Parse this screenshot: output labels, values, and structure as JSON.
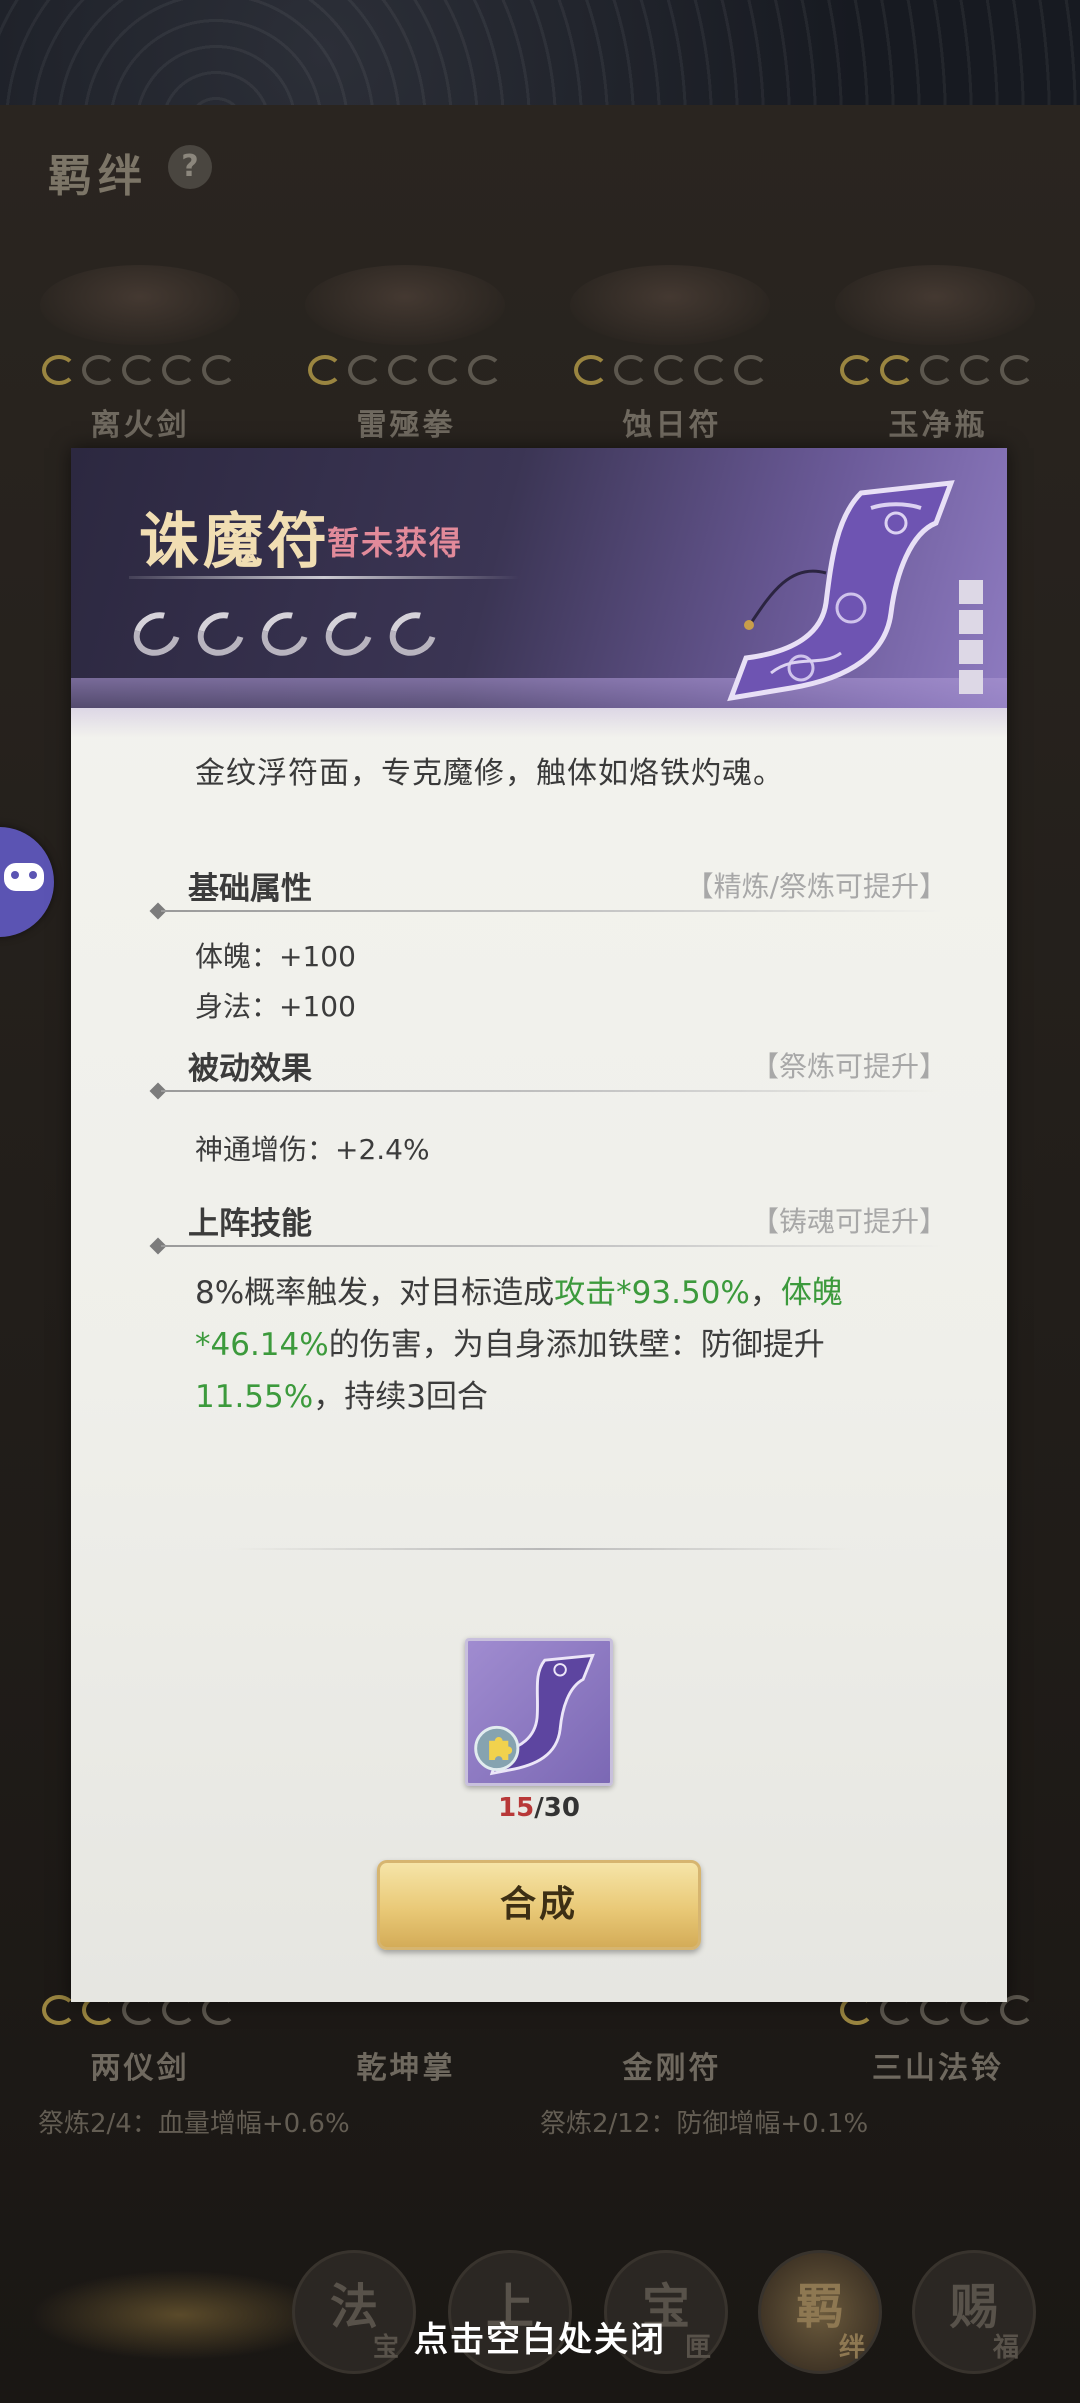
{
  "background": {
    "title": "羁绊",
    "help_icon": "?",
    "items_top": [
      {
        "name": "离火剑"
      },
      {
        "name": "雷殛拳"
      },
      {
        "name": "蚀日符"
      },
      {
        "name": "玉净瓶"
      }
    ],
    "items_bottom": [
      {
        "name": "两仪剑"
      },
      {
        "name": "乾坤掌"
      },
      {
        "name": "金刚符"
      },
      {
        "name": "三山法铃"
      }
    ],
    "stats_bottom": [
      "祭炼2/4：血量增幅+0.6%",
      "祭炼2/12：防御增幅+0.1%"
    ],
    "nav_tabs": [
      {
        "label": "法",
        "sub": "宝"
      },
      {
        "label": "上",
        "sub": ""
      },
      {
        "label": "宝",
        "sub": "匣"
      },
      {
        "label": "羁",
        "sub": "绊",
        "active": true
      },
      {
        "label": "赐",
        "sub": "福"
      }
    ]
  },
  "modal": {
    "item_name": "诛魔符",
    "status": "暂未获得",
    "rank_stars": 5,
    "description": "金纹浮符面，专克魔修，触体如烙铁灼魂。",
    "sections": {
      "base": {
        "title": "基础属性",
        "hint": "【精炼/祭炼可提升】",
        "stats": [
          "体魄：+100",
          "身法：+100"
        ]
      },
      "passive": {
        "title": "被动效果",
        "hint": "【祭炼可提升】",
        "stats": [
          "神通增伤：+2.4%"
        ]
      },
      "skill": {
        "title": "上阵技能",
        "hint": "【铸魂可提升】",
        "parts": {
          "p1": "8%概率触发，对目标造成",
          "g1": "攻击*93.50%",
          "p2": "，",
          "g2": "体魄*46.14%",
          "p3": "的伤害，为自身添加铁壁：防御提升",
          "g3": "11.55%",
          "p4": "，持续3回合"
        }
      }
    },
    "fragments": {
      "have": "15",
      "need": "/30"
    },
    "craft_button": "合成"
  },
  "close_hint": "点击空白处关闭",
  "colors": {
    "accent_gold": "#e9c977",
    "status_red": "#e28a9a",
    "highlight_green": "#3c9a3c",
    "header_purple": "#6c5b9a"
  }
}
